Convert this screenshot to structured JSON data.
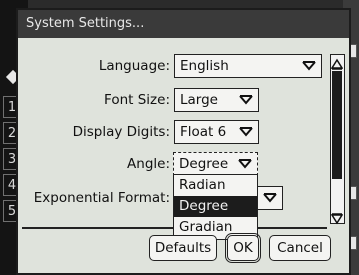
{
  "dialog": {
    "title": "System Settings..."
  },
  "settings": {
    "language": {
      "label": "Language:",
      "value": "English"
    },
    "font_size": {
      "label": "Font Size:",
      "value": "Large"
    },
    "display_digits": {
      "label": "Display Digits:",
      "value": "Float 6"
    },
    "angle": {
      "label": "Angle:",
      "value": "Degree",
      "options": [
        "Radian",
        "Degree",
        "Gradian"
      ],
      "selected": "Degree"
    },
    "exponential_format": {
      "label": "Exponential Format:"
    }
  },
  "buttons": {
    "defaults": "Defaults",
    "ok": "OK",
    "cancel": "Cancel"
  },
  "side_tabs": [
    "1",
    "2",
    "3",
    "4",
    "5"
  ]
}
